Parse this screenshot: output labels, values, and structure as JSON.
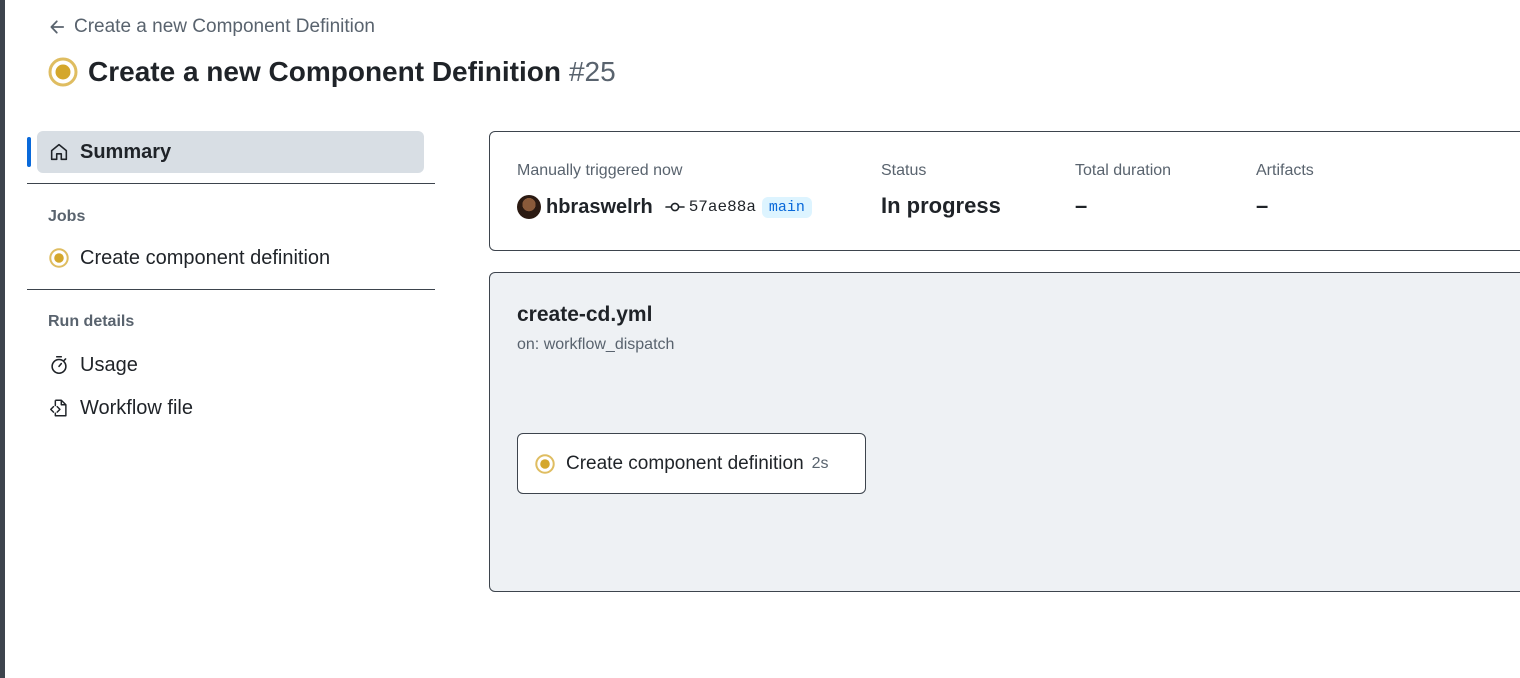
{
  "header": {
    "back_label": "Create a new Component Definition",
    "title": "Create a new Component Definition",
    "run_number": "#25"
  },
  "sidebar": {
    "summary_label": "Summary",
    "jobs_heading": "Jobs",
    "jobs": [
      {
        "label": "Create component definition"
      }
    ],
    "run_details_heading": "Run details",
    "usage_label": "Usage",
    "workflow_file_label": "Workflow file"
  },
  "summary": {
    "trigger_label": "Manually triggered now",
    "actor": "hbraswelrh",
    "commit_sha": "57ae88a",
    "branch": "main",
    "status_label": "Status",
    "status_value": "In progress",
    "duration_label": "Total duration",
    "duration_value": "–",
    "artifacts_label": "Artifacts",
    "artifacts_value": "–"
  },
  "graph": {
    "workflow_file": "create-cd.yml",
    "trigger": "on: workflow_dispatch",
    "job_name": "Create component definition",
    "job_duration": "2s"
  },
  "colors": {
    "in_progress": "#d4a72c",
    "accent": "#0969da",
    "branch_bg": "#ddf4ff",
    "selected_bg": "#d8dee4"
  },
  "icons": {
    "back": "arrow-left-icon",
    "status": "in-progress-icon",
    "summary": "home-icon",
    "usage": "stopwatch-icon",
    "workflow_file": "file-code-icon",
    "commit": "git-commit-icon"
  }
}
